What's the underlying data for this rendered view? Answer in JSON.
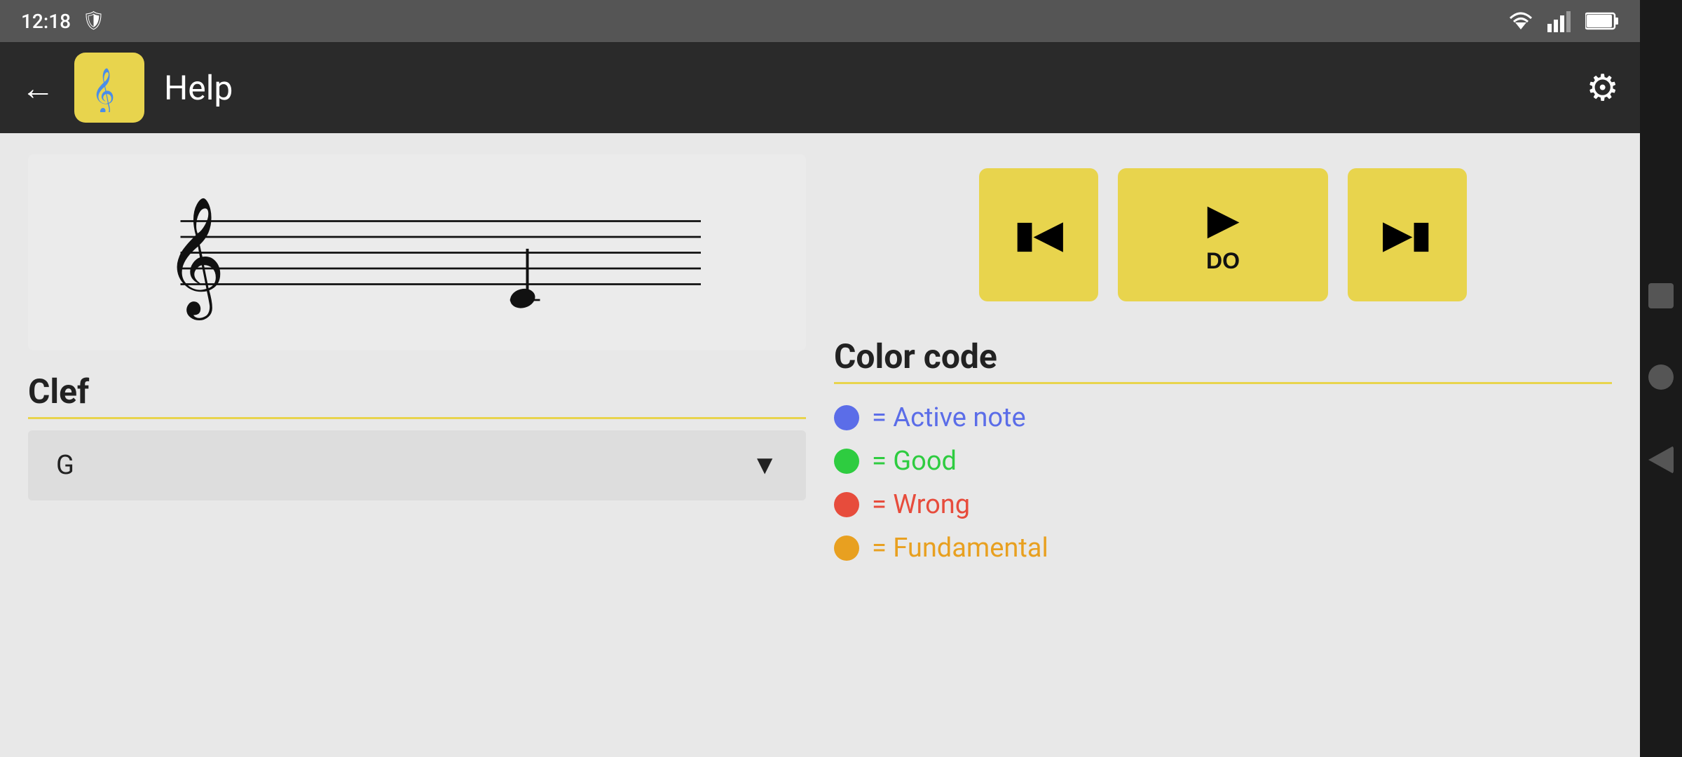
{
  "statusBar": {
    "time": "12:18",
    "wifi": "▲",
    "signal": "◀",
    "battery": "▮"
  },
  "topBar": {
    "back_label": "←",
    "title": "Help",
    "app_icon": "🎵",
    "settings_icon": "⚙"
  },
  "staff": {
    "description": "Music staff with treble clef and note"
  },
  "playback": {
    "prev_icon": "⏮",
    "play_icon": "▶",
    "note_label": "DO",
    "next_icon": "⏭"
  },
  "clef": {
    "section_title": "Clef",
    "selected_value": "G",
    "dropdown_icon": "▼"
  },
  "colorCode": {
    "section_title": "Color code",
    "items": [
      {
        "color": "#5b6de8",
        "label": "= Active note"
      },
      {
        "color": "#2ecc40",
        "label": "= Good"
      },
      {
        "color": "#e74c3c",
        "label": "= Wrong"
      },
      {
        "color": "#e8a020",
        "label": "= Fundamental"
      }
    ]
  },
  "colors": {
    "active_note": "#5b6de8",
    "good": "#2ecc40",
    "wrong": "#e74c3c",
    "fundamental": "#e8a020",
    "accent": "#e8d44d"
  }
}
